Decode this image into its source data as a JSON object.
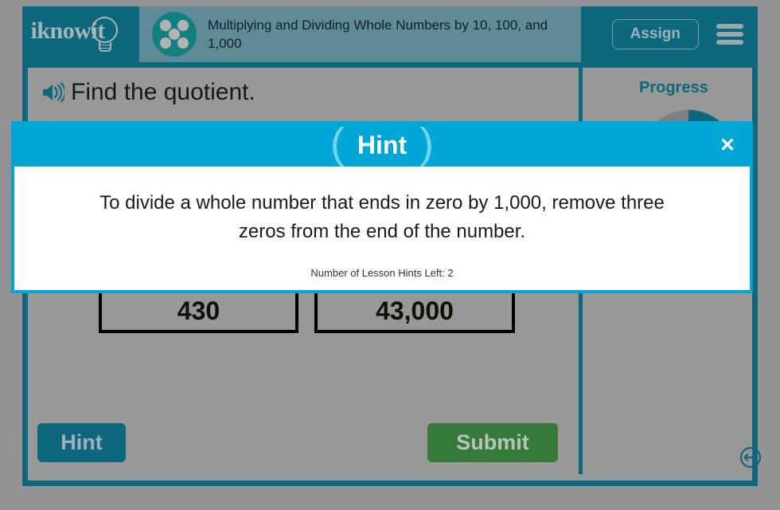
{
  "header": {
    "logo_text": "iknowit",
    "logo_icon": "lightbulb-icon",
    "lesson_title": "Multiplying and Dividing Whole Numbers by 10, 100, and 1,000",
    "lesson_icon": "five-dot-circle-icon",
    "assign_label": "Assign",
    "menu_icon": "hamburger-menu-icon",
    "colors": {
      "bar": "#0d687e",
      "title_panel": "#5f8b96",
      "lesson_icon": "#12807f"
    }
  },
  "question": {
    "audio_icon": "speaker-icon",
    "prompt": "Find the quotient."
  },
  "answers": {
    "choices": [
      {
        "label": "430"
      },
      {
        "label": "43,000"
      }
    ]
  },
  "actions": {
    "hint_label": "Hint",
    "submit_label": "Submit",
    "hint_color": "#0d687e",
    "submit_color": "#357a38"
  },
  "progress": {
    "title": "Progress",
    "gauge_icon": "progress-gauge-icon",
    "gauge_fill_color": "#0d687e",
    "gauge_track_color": "#808080"
  },
  "footer": {
    "resize_icon": "resize-horizontal-icon"
  },
  "hint_modal": {
    "title": "Hint",
    "close_icon": "close-icon",
    "body_text": "To divide a whole number that ends in zero by 1,000, remove three zeros from the end of the number.",
    "hints_left_text": "Number of Lesson Hints Left: 2",
    "accent_color": "#00a6d6"
  }
}
